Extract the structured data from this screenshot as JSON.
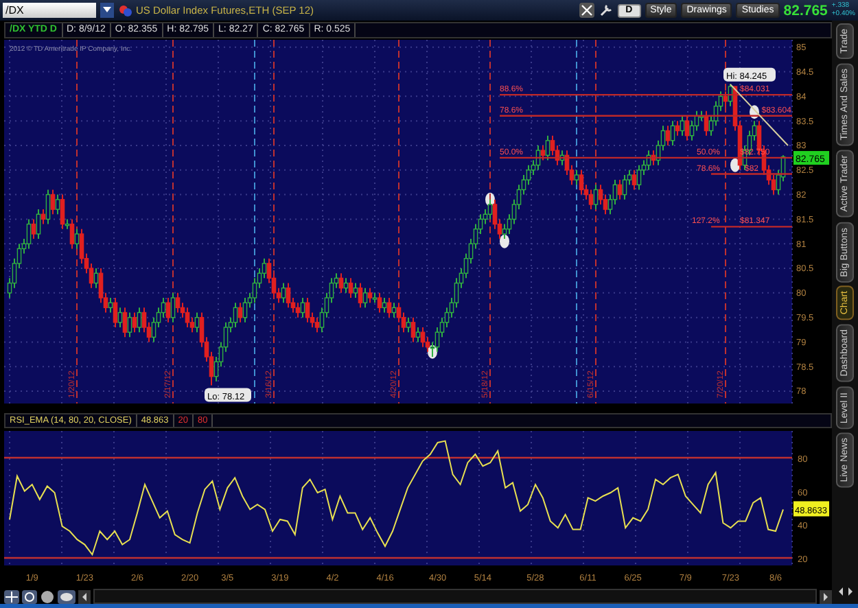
{
  "toolbar": {
    "symbol": "/DX",
    "title": "US Dollar Index Futures,ETH (SEP 12)",
    "aggregation": "D",
    "buttons": [
      "Style",
      "Drawings",
      "Studies"
    ],
    "last_price": "82.765",
    "change": "+.338",
    "change_percent": "+0.40%"
  },
  "info_bar": {
    "label": "/DX YTD D",
    "fields": [
      "D: 8/9/12",
      "O: 82.355",
      "H: 82.795",
      "L: 82.27",
      "C: 82.765",
      "R: 0.525"
    ]
  },
  "copyright": "2012 © TD Ameritrade IP Company, Inc.",
  "price_chart": {
    "event_dates": [
      "1/20/12",
      "2/17/12",
      "3/16/12",
      "4/20/12",
      "5/18/12",
      "6/15/12",
      "7/20/12"
    ],
    "fib_levels": [
      {
        "texts": [
          "88.6%",
          "$84.031"
        ]
      },
      {
        "texts": [
          "78.6%",
          "$83.604"
        ]
      },
      {
        "texts": [
          "50.0%",
          "50.0%",
          "$82.750"
        ]
      },
      {
        "texts": [
          "78.6%",
          "$82"
        ]
      },
      {
        "texts": [
          "127.2%",
          "$81.347"
        ]
      }
    ],
    "high_label": "Hi: 84.245",
    "low_label": "Lo: 78.12",
    "price_tag": "82.765",
    "chart_data": {
      "type": "candlestick",
      "grid": true,
      "ylim": [
        77.75,
        85.15
      ],
      "yticks": [
        78,
        78.5,
        79,
        79.5,
        80,
        80.5,
        81,
        81.5,
        82,
        82.5,
        83,
        83.5,
        84,
        84.5,
        85
      ],
      "categories": [
        null,
        null,
        null,
        null,
        null,
        null,
        null,
        null,
        null,
        null,
        null,
        null,
        null,
        null,
        null,
        null,
        null,
        null,
        null,
        null,
        null,
        null,
        null,
        null,
        null,
        null,
        null,
        null,
        null,
        null,
        null,
        null,
        null,
        null,
        null,
        null,
        null,
        null,
        null,
        null,
        null,
        null,
        null,
        null,
        null,
        null,
        null,
        null,
        null,
        null,
        null,
        null,
        null,
        null,
        null,
        null,
        null,
        null,
        null,
        null,
        null,
        null,
        null,
        null,
        null,
        null,
        null,
        null,
        null,
        null,
        null,
        null,
        null,
        null,
        null,
        null,
        null,
        null,
        null,
        null,
        null,
        null,
        null,
        null,
        null,
        null,
        null,
        null,
        null,
        null,
        null,
        null,
        null,
        null,
        null,
        null,
        null,
        null,
        null,
        null,
        null,
        null,
        null,
        null,
        null,
        null,
        null,
        null,
        null,
        null,
        null,
        null,
        null,
        null,
        null,
        null,
        null,
        null,
        null,
        null,
        null,
        null,
        null,
        null,
        null,
        null,
        null,
        null,
        null,
        null,
        null,
        null,
        null,
        null,
        null,
        null,
        null,
        null,
        null,
        null,
        null,
        null,
        null,
        null,
        null,
        null,
        null,
        null,
        null,
        null,
        null,
        null,
        null,
        null,
        null,
        null,
        null,
        null,
        null,
        null,
        null,
        null
      ],
      "ohlc": [
        [
          80.0,
          80.3,
          79.9,
          80.2
        ],
        [
          80.2,
          80.7,
          80.1,
          80.6
        ],
        [
          80.6,
          81.0,
          80.5,
          80.9
        ],
        [
          80.9,
          81.1,
          80.8,
          81.0
        ],
        [
          81.0,
          81.5,
          80.9,
          81.4
        ],
        [
          81.4,
          81.5,
          81.1,
          81.2
        ],
        [
          81.2,
          81.7,
          81.1,
          81.6
        ],
        [
          81.6,
          81.7,
          81.4,
          81.5
        ],
        [
          81.5,
          82.1,
          81.4,
          82.0
        ],
        [
          82.0,
          82.1,
          81.6,
          81.7
        ],
        [
          81.7,
          82.0,
          81.6,
          81.9
        ],
        [
          81.9,
          82.0,
          81.3,
          81.4
        ],
        [
          81.4,
          81.5,
          81.3,
          81.4
        ],
        [
          81.4,
          81.5,
          80.9,
          81.0
        ],
        [
          81.0,
          81.3,
          80.9,
          81.2
        ],
        [
          81.2,
          81.3,
          80.6,
          80.7
        ],
        [
          80.7,
          80.8,
          80.4,
          80.5
        ],
        [
          80.5,
          80.6,
          80.1,
          80.2
        ],
        [
          80.2,
          80.5,
          80.1,
          80.4
        ],
        [
          80.4,
          80.5,
          79.8,
          79.9
        ],
        [
          79.9,
          80.0,
          79.6,
          79.7
        ],
        [
          79.7,
          79.9,
          79.6,
          79.8
        ],
        [
          79.8,
          79.9,
          79.3,
          79.4
        ],
        [
          79.4,
          79.7,
          79.3,
          79.6
        ],
        [
          79.6,
          79.7,
          79.1,
          79.2
        ],
        [
          79.2,
          79.6,
          79.1,
          79.5
        ],
        [
          79.5,
          79.6,
          79.2,
          79.3
        ],
        [
          79.3,
          79.7,
          79.2,
          79.6
        ],
        [
          79.6,
          79.7,
          79.2,
          79.3
        ],
        [
          79.3,
          79.4,
          79.0,
          79.1
        ],
        [
          79.1,
          79.5,
          79.0,
          79.4
        ],
        [
          79.4,
          79.7,
          79.3,
          79.6
        ],
        [
          79.6,
          79.9,
          79.5,
          79.8
        ],
        [
          79.8,
          79.9,
          79.4,
          79.5
        ],
        [
          79.5,
          80.0,
          79.4,
          79.9
        ],
        [
          79.9,
          80.0,
          79.6,
          79.7
        ],
        [
          79.7,
          79.8,
          79.5,
          79.6
        ],
        [
          79.6,
          79.7,
          79.3,
          79.4
        ],
        [
          79.4,
          79.5,
          79.2,
          79.3
        ],
        [
          79.3,
          79.6,
          79.2,
          79.5
        ],
        [
          79.5,
          79.6,
          78.9,
          79.0
        ],
        [
          79.0,
          79.1,
          78.6,
          78.7
        ],
        [
          78.7,
          78.8,
          78.12,
          78.3
        ],
        [
          78.3,
          78.7,
          78.2,
          78.6
        ],
        [
          78.6,
          79.0,
          78.5,
          78.9
        ],
        [
          78.9,
          79.4,
          78.8,
          79.3
        ],
        [
          79.3,
          79.5,
          79.2,
          79.4
        ],
        [
          79.4,
          79.8,
          79.3,
          79.7
        ],
        [
          79.7,
          79.8,
          79.4,
          79.5
        ],
        [
          79.5,
          79.9,
          79.4,
          79.8
        ],
        [
          79.8,
          80.0,
          79.7,
          79.9
        ],
        [
          79.9,
          80.3,
          79.8,
          80.2
        ],
        [
          80.2,
          80.5,
          80.1,
          80.4
        ],
        [
          80.4,
          80.7,
          80.3,
          80.6
        ],
        [
          80.6,
          80.7,
          80.2,
          80.3
        ],
        [
          80.3,
          80.4,
          79.9,
          80.0
        ],
        [
          80.0,
          80.1,
          79.8,
          79.9
        ],
        [
          79.9,
          80.2,
          79.8,
          80.1
        ],
        [
          80.1,
          80.2,
          79.7,
          79.8
        ],
        [
          79.8,
          79.9,
          79.6,
          79.7
        ],
        [
          79.7,
          79.8,
          79.5,
          79.6
        ],
        [
          79.6,
          79.9,
          79.5,
          79.8
        ],
        [
          79.8,
          79.9,
          79.4,
          79.5
        ],
        [
          79.5,
          79.6,
          79.3,
          79.4
        ],
        [
          79.4,
          79.5,
          79.2,
          79.3
        ],
        [
          79.3,
          79.7,
          79.2,
          79.6
        ],
        [
          79.6,
          80.0,
          79.5,
          79.9
        ],
        [
          79.9,
          80.3,
          79.8,
          80.2
        ],
        [
          80.2,
          80.4,
          80.1,
          80.3
        ],
        [
          80.3,
          80.4,
          80.0,
          80.1
        ],
        [
          80.1,
          80.3,
          80.0,
          80.2
        ],
        [
          80.2,
          80.3,
          79.9,
          80.0
        ],
        [
          80.0,
          80.2,
          79.9,
          80.1
        ],
        [
          80.1,
          80.2,
          79.7,
          79.8
        ],
        [
          79.8,
          80.1,
          79.7,
          80.0
        ],
        [
          80.0,
          80.1,
          79.8,
          79.9
        ],
        [
          79.9,
          80.0,
          79.8,
          79.9
        ],
        [
          79.9,
          80.0,
          79.6,
          79.7
        ],
        [
          79.7,
          79.9,
          79.6,
          79.8
        ],
        [
          79.8,
          79.9,
          79.5,
          79.6
        ],
        [
          79.6,
          79.8,
          79.5,
          79.7
        ],
        [
          79.7,
          79.8,
          79.4,
          79.5
        ],
        [
          79.5,
          79.6,
          79.2,
          79.3
        ],
        [
          79.3,
          79.5,
          79.2,
          79.4
        ],
        [
          79.4,
          79.5,
          79.0,
          79.1
        ],
        [
          79.1,
          79.3,
          79.0,
          79.2
        ],
        [
          79.2,
          79.3,
          78.9,
          79.0
        ],
        [
          79.0,
          79.1,
          78.8,
          78.9
        ],
        [
          78.9,
          79.0,
          78.7,
          78.9
        ],
        [
          78.9,
          79.3,
          78.8,
          79.2
        ],
        [
          79.2,
          79.5,
          79.1,
          79.4
        ],
        [
          79.4,
          79.7,
          79.3,
          79.6
        ],
        [
          79.6,
          79.9,
          79.5,
          79.8
        ],
        [
          79.8,
          80.3,
          79.7,
          80.2
        ],
        [
          80.2,
          80.5,
          80.1,
          80.4
        ],
        [
          80.4,
          80.8,
          80.3,
          80.7
        ],
        [
          80.7,
          81.1,
          80.6,
          81.0
        ],
        [
          81.0,
          81.4,
          80.9,
          81.3
        ],
        [
          81.3,
          81.6,
          81.2,
          81.5
        ],
        [
          81.5,
          81.7,
          81.4,
          81.6
        ],
        [
          81.6,
          81.9,
          81.5,
          81.8
        ],
        [
          81.8,
          81.9,
          81.3,
          81.4
        ],
        [
          81.4,
          81.5,
          81.1,
          81.2
        ],
        [
          81.2,
          81.4,
          81.1,
          81.3
        ],
        [
          81.3,
          81.6,
          81.2,
          81.5
        ],
        [
          81.5,
          81.9,
          81.4,
          81.8
        ],
        [
          81.8,
          82.2,
          81.7,
          82.1
        ],
        [
          82.1,
          82.4,
          82.0,
          82.3
        ],
        [
          82.3,
          82.6,
          82.2,
          82.5
        ],
        [
          82.5,
          82.7,
          82.4,
          82.6
        ],
        [
          82.6,
          83.0,
          82.5,
          82.9
        ],
        [
          82.9,
          83.0,
          82.7,
          82.8
        ],
        [
          82.8,
          83.2,
          82.7,
          83.1
        ],
        [
          83.1,
          83.2,
          82.8,
          82.9
        ],
        [
          82.9,
          83.0,
          82.6,
          82.7
        ],
        [
          82.7,
          82.9,
          82.6,
          82.8
        ],
        [
          82.8,
          82.9,
          82.4,
          82.5
        ],
        [
          82.5,
          82.6,
          82.2,
          82.3
        ],
        [
          82.3,
          82.5,
          82.2,
          82.4
        ],
        [
          82.4,
          82.5,
          82.0,
          82.1
        ],
        [
          82.1,
          82.2,
          81.9,
          82.0
        ],
        [
          82.0,
          82.1,
          81.7,
          81.8
        ],
        [
          81.8,
          82.2,
          81.7,
          82.1
        ],
        [
          82.1,
          82.2,
          81.8,
          81.9
        ],
        [
          81.9,
          82.0,
          81.6,
          81.7
        ],
        [
          81.7,
          82.0,
          81.6,
          81.9
        ],
        [
          81.9,
          82.3,
          81.8,
          82.2
        ],
        [
          82.2,
          82.3,
          81.9,
          82.0
        ],
        [
          82.0,
          82.4,
          81.9,
          82.3
        ],
        [
          82.3,
          82.5,
          82.2,
          82.4
        ],
        [
          82.4,
          82.5,
          82.1,
          82.2
        ],
        [
          82.2,
          82.6,
          82.1,
          82.5
        ],
        [
          82.5,
          82.7,
          82.4,
          82.6
        ],
        [
          82.6,
          82.9,
          82.5,
          82.8
        ],
        [
          82.8,
          82.9,
          82.6,
          82.7
        ],
        [
          82.7,
          83.1,
          82.6,
          83.0
        ],
        [
          83.0,
          83.4,
          82.9,
          83.3
        ],
        [
          83.3,
          83.4,
          83.0,
          83.1
        ],
        [
          83.1,
          83.5,
          83.0,
          83.4
        ],
        [
          83.4,
          83.5,
          83.2,
          83.3
        ],
        [
          83.3,
          83.6,
          83.2,
          83.5
        ],
        [
          83.5,
          83.6,
          83.1,
          83.2
        ],
        [
          83.2,
          83.5,
          83.1,
          83.4
        ],
        [
          83.4,
          83.7,
          83.3,
          83.6
        ],
        [
          83.6,
          83.7,
          83.5,
          83.6
        ],
        [
          83.6,
          83.7,
          83.2,
          83.3
        ],
        [
          83.3,
          83.6,
          83.2,
          83.5
        ],
        [
          83.5,
          83.9,
          83.4,
          83.8
        ],
        [
          83.8,
          84.1,
          83.7,
          84.0
        ],
        [
          84.0,
          84.1,
          83.8,
          83.9
        ],
        [
          83.9,
          84.25,
          83.8,
          84.2
        ],
        [
          84.2,
          84.2,
          83.3,
          83.4
        ],
        [
          83.4,
          83.5,
          82.5,
          82.6
        ],
        [
          82.6,
          83.0,
          82.5,
          82.9
        ],
        [
          82.9,
          83.3,
          82.8,
          83.2
        ],
        [
          83.2,
          83.5,
          83.1,
          83.4
        ],
        [
          83.4,
          83.5,
          82.8,
          82.9
        ],
        [
          82.9,
          83.0,
          82.4,
          82.5
        ],
        [
          82.5,
          82.6,
          82.2,
          82.3
        ],
        [
          82.3,
          82.4,
          82.0,
          82.1
        ],
        [
          82.1,
          82.5,
          82.0,
          82.4
        ],
        [
          82.36,
          82.8,
          82.27,
          82.77
        ]
      ]
    }
  },
  "study": {
    "value": "48.863",
    "levels": [
      "20",
      "80"
    ],
    "value_tag": "48.8633",
    "chart_data": {
      "type": "line",
      "ylim": [
        15.5,
        96
      ],
      "yticks": [
        20,
        40,
        60,
        80
      ],
      "grid": true,
      "categories": [
        null,
        null,
        null,
        "1/9",
        null,
        null,
        null,
        null,
        null,
        null,
        "1/23",
        null,
        null,
        null,
        null,
        null,
        null,
        "2/6",
        null,
        null,
        null,
        null,
        null,
        null,
        "2/20",
        null,
        null,
        null,
        null,
        "3/5",
        null,
        null,
        null,
        null,
        null,
        null,
        "3/19",
        null,
        null,
        null,
        null,
        null,
        null,
        "4/2",
        null,
        null,
        null,
        null,
        null,
        null,
        "4/16",
        null,
        null,
        null,
        null,
        null,
        null,
        "4/30",
        null,
        null,
        null,
        null,
        null,
        "5/14",
        null,
        null,
        null,
        null,
        null,
        null,
        "5/28",
        null,
        null,
        null,
        null,
        null,
        null,
        "6/11",
        null,
        null,
        null,
        null,
        null,
        "6/25",
        null,
        null,
        null,
        null,
        null,
        null,
        "7/9",
        null,
        null,
        null,
        null,
        null,
        "7/23",
        null,
        null,
        null,
        null,
        null,
        "8/6",
        null
      ],
      "series": [
        {
          "name": "RSI_EMA (14, 80, 20, CLOSE)",
          "color": "#e8e050",
          "values": [
            43,
            69,
            60,
            64,
            55,
            63,
            59,
            39,
            36,
            31,
            28,
            22,
            36,
            31,
            36,
            28,
            31,
            47,
            64,
            54,
            44,
            48,
            34,
            31,
            29,
            47,
            61,
            66,
            49,
            62,
            68,
            57,
            49,
            52,
            49,
            36,
            43,
            42,
            34,
            62,
            67,
            59,
            61,
            43,
            57,
            47,
            47,
            37,
            44,
            35,
            27,
            36,
            49,
            62,
            70,
            78,
            82,
            89,
            90,
            70,
            64,
            77,
            82,
            75,
            77,
            84,
            62,
            65,
            48,
            52,
            64,
            56,
            42,
            38,
            46,
            37,
            37,
            56,
            54,
            57,
            59,
            62,
            38,
            44,
            42,
            49,
            67,
            64,
            68,
            70,
            57,
            52,
            47,
            64,
            71,
            41,
            38,
            42,
            42,
            53,
            56,
            37,
            36,
            49
          ]
        }
      ]
    }
  },
  "side_tabs": [
    {
      "label": "Trade",
      "selected": false
    },
    {
      "label": "Times And Sales",
      "selected": false
    },
    {
      "label": "Active Trader",
      "selected": false
    },
    {
      "label": "Big Buttons",
      "selected": false
    },
    {
      "label": "Chart",
      "selected": true
    },
    {
      "label": "Dashboard",
      "selected": false
    },
    {
      "label": "Level II",
      "selected": false
    },
    {
      "label": "Live News",
      "selected": false
    }
  ]
}
